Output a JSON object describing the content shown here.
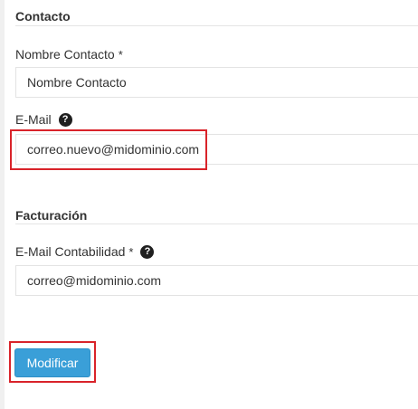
{
  "sections": {
    "contact": {
      "title": "Contacto",
      "name_field": {
        "label": "Nombre Contacto",
        "required_mark": "*",
        "value": "Nombre Contacto"
      },
      "email_field": {
        "label": "E-Mail",
        "value": "correo.nuevo@midominio.com",
        "help_icon": "question-circle-icon"
      }
    },
    "billing": {
      "title": "Facturación",
      "accounting_email_field": {
        "label": "E-Mail Contabilidad",
        "required_mark": "*",
        "value": "correo@midominio.com",
        "help_icon": "question-circle-icon"
      }
    }
  },
  "actions": {
    "submit_label": "Modificar"
  },
  "colors": {
    "button_primary": "#3a9fd8",
    "highlight": "#d9232a"
  }
}
